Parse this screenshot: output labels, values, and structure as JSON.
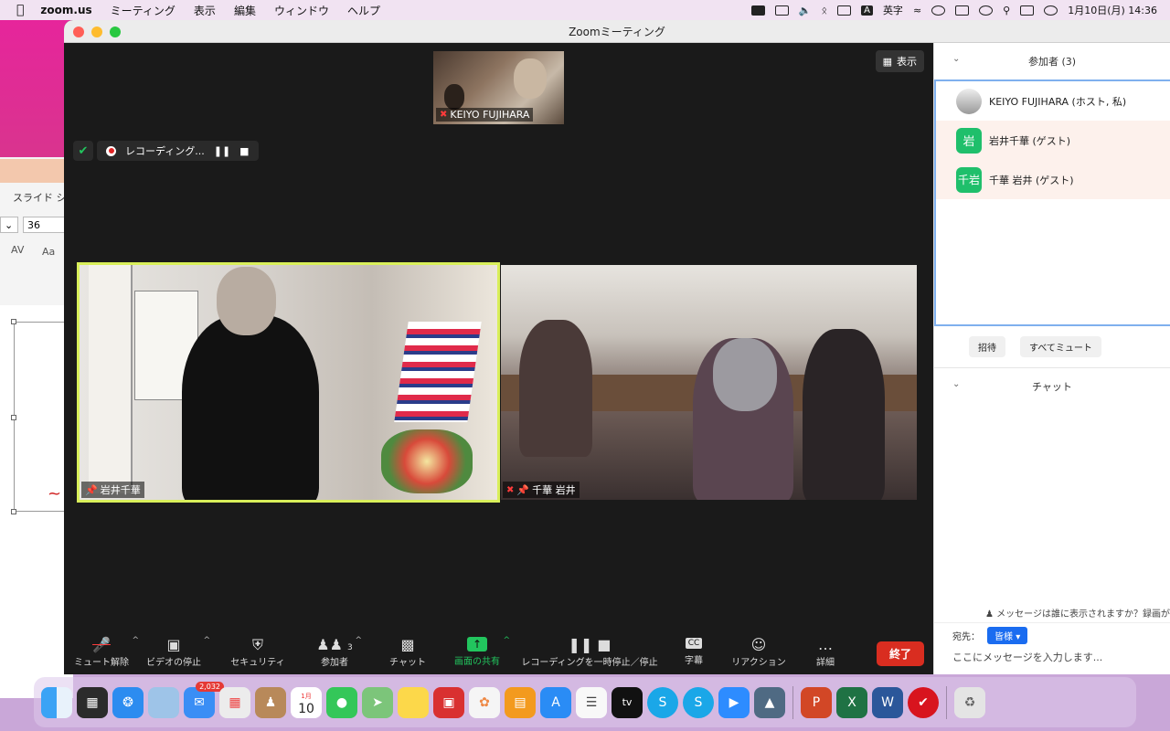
{
  "menubar": {
    "app_name": "zoom.us",
    "menus": [
      "ミーティング",
      "表示",
      "編集",
      "ウィンドウ",
      "ヘルプ"
    ],
    "ime_label": "英字",
    "ime_glyph": "A",
    "datetime": "1月10日(月)  14:36"
  },
  "background_window": {
    "tab_label": "スライド シ",
    "font_size": "36",
    "av_label": "AV",
    "aa_label": "Aa"
  },
  "zoom": {
    "window_title": "Zoomミーティング",
    "view_button": "表示",
    "recording_label": "レコーディング...",
    "top_participant_name": "KEIYO FUJIHARA",
    "tiles": [
      {
        "name": "岩井千華"
      },
      {
        "name": "千華 岩井"
      }
    ],
    "toolbar": {
      "unmute": "ミュート解除",
      "stop_video": "ビデオの停止",
      "security": "セキュリティ",
      "participants": "参加者",
      "participants_count": "3",
      "chat": "チャット",
      "share_screen": "画面の共有",
      "pause_stop_recording": "レコーディングを一時停止／停止",
      "captions": "字幕",
      "captions_icon": "CC",
      "reactions": "リアクション",
      "more": "詳細",
      "end": "終了"
    },
    "participants_panel": {
      "title": "参加者 (3)",
      "participants": [
        {
          "name": "KEIYO FUJIHARA (ホスト, 私)",
          "avatar": ""
        },
        {
          "name": "岩井千華 (ゲスト)",
          "avatar": "岩"
        },
        {
          "name": "千華 岩井 (ゲスト)",
          "avatar": "千岩"
        }
      ],
      "invite": "招待",
      "mute_all": "すべてミュート"
    },
    "chat_panel": {
      "title": "チャット",
      "who_can_see": "メッセージは誰に表示されますか？録画が",
      "to_label": "宛先：",
      "to_value": "皆様",
      "input_placeholder": "ここにメッセージを入力します..."
    }
  },
  "dock": {
    "mail_badge": "2,032",
    "calendar_month": "1月",
    "calendar_day": "10"
  }
}
